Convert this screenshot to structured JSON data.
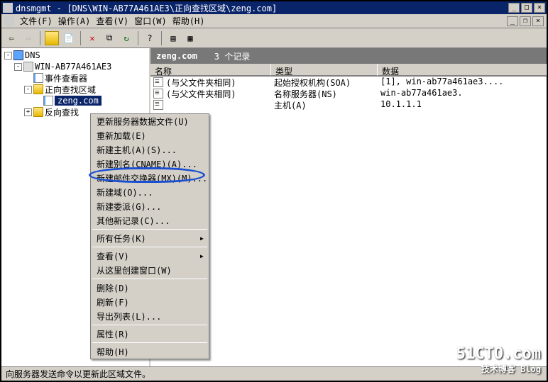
{
  "title": "dnsmgmt - [DNS\\WIN-AB77A461AE3\\正向查找区域\\zeng.com]",
  "menubar": {
    "file": "文件(F)",
    "action": "操作(A)",
    "view": "查看(V)",
    "window": "窗口(W)",
    "help": "帮助(H)"
  },
  "tree": {
    "root": "DNS",
    "server": "WIN-AB77A461AE3",
    "event": "事件查看器",
    "fwdzone": "正向查找区域",
    "selected": "zeng.com",
    "revzone": "反向查找"
  },
  "zonebar": {
    "name": "zeng.com",
    "count": "3 个记录"
  },
  "columns": {
    "name": "名称",
    "type": "类型",
    "data": "数据"
  },
  "records": [
    {
      "name": "(与父文件夹相同)",
      "type": "起始授权机构(SOA)",
      "data": "[1], win-ab77a461ae3...."
    },
    {
      "name": "(与父文件夹相同)",
      "type": "名称服务器(NS)",
      "data": "win-ab77a461ae3."
    },
    {
      "name": "",
      "type": "主机(A)",
      "data": "10.1.1.1"
    }
  ],
  "ctx": [
    "更新服务器数据文件(U)",
    "重新加载(E)",
    "新建主机(A)(S)...",
    "新建别名(CNAME)(A)...",
    "新建邮件交换器(MX)(M)...",
    "新建域(O)...",
    "新建委派(G)...",
    "其他新记录(C)...",
    "所有任务(K)",
    "查看(V)",
    "从这里创建窗口(W)",
    "删除(D)",
    "刷新(F)",
    "导出列表(L)...",
    "属性(R)",
    "帮助(H)"
  ],
  "status": "向服务器发送命令以更新此区域文件。",
  "watermark": {
    "big": "51CTO.com",
    "sub": "技术博客  Blog"
  }
}
